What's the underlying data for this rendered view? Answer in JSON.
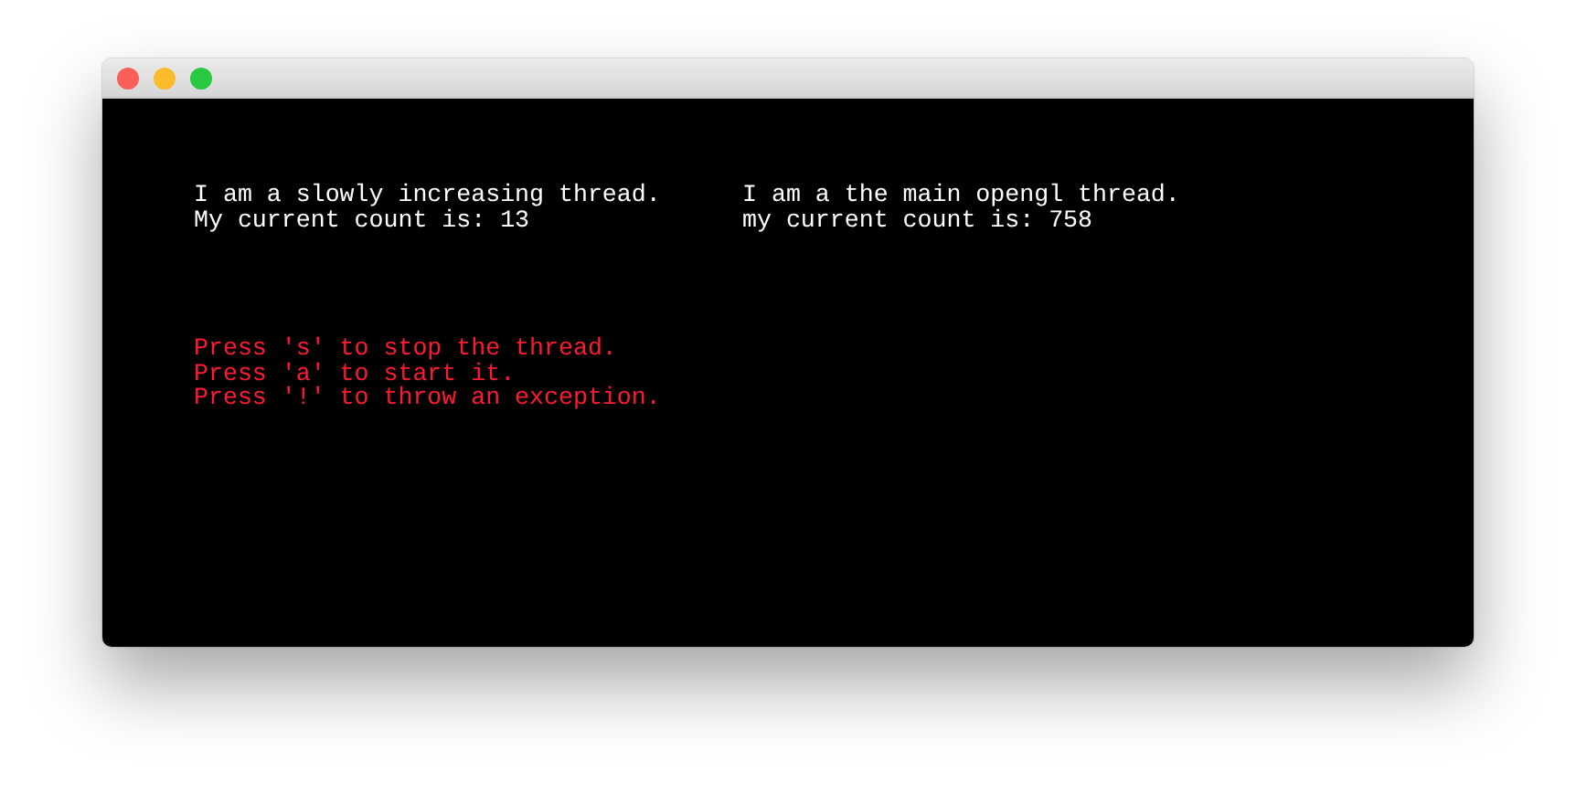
{
  "window": {
    "controls": [
      {
        "kind": "close"
      },
      {
        "kind": "minimize"
      },
      {
        "kind": "zoom"
      }
    ]
  },
  "threads": [
    {
      "lines": [
        "I am a slowly increasing thread.",
        "My current count is: 13"
      ]
    },
    {
      "lines": [
        "I am a the main opengl thread.",
        "my current count is: 758"
      ]
    }
  ],
  "instructions": [
    "Press 's' to stop the thread.",
    "Press 'a' to start it.",
    "Press '!' to throw an exception."
  ]
}
